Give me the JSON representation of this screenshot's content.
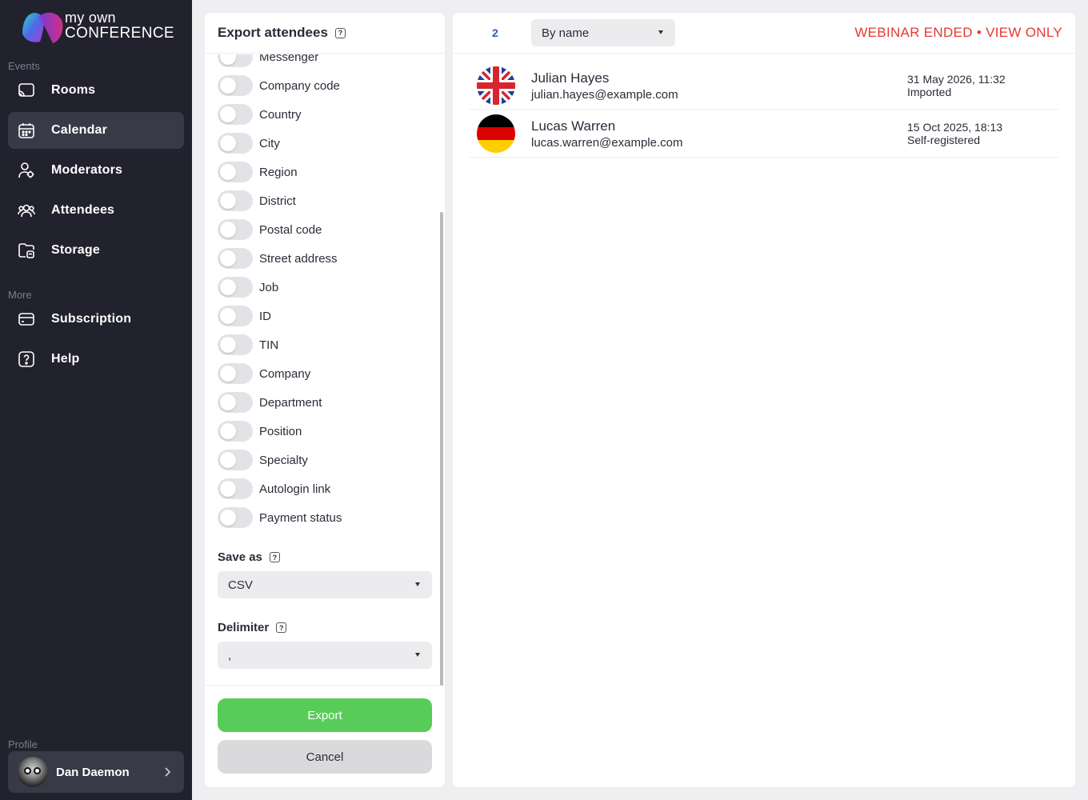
{
  "brand": {
    "line1": "my own",
    "line2": "CONFERENCE"
  },
  "sidebar": {
    "events_label": "Events",
    "more_label": "More",
    "profile_label": "Profile",
    "items": [
      {
        "label": "Rooms",
        "icon": "cast-icon",
        "active": false
      },
      {
        "label": "Calendar",
        "icon": "calendar-icon",
        "active": true
      },
      {
        "label": "Moderators",
        "icon": "user-gear-icon",
        "active": false
      },
      {
        "label": "Attendees",
        "icon": "users-icon",
        "active": false
      },
      {
        "label": "Storage",
        "icon": "folder-icon",
        "active": false
      }
    ],
    "more_items": [
      {
        "label": "Subscription",
        "icon": "card-icon"
      },
      {
        "label": "Help",
        "icon": "help-icon"
      }
    ],
    "profile_name": "Dan Daemon"
  },
  "export": {
    "title": "Export attendees",
    "fields": [
      "Messenger",
      "Company code",
      "Country",
      "City",
      "Region",
      "District",
      "Postal code",
      "Street address",
      "Job",
      "ID",
      "TIN",
      "Company",
      "Department",
      "Position",
      "Specialty",
      "Autologin link",
      "Payment status"
    ],
    "save_as_label": "Save as",
    "save_as_value": "CSV",
    "delimiter_label": "Delimiter",
    "delimiter_value": ",",
    "export_button": "Export",
    "cancel_button": "Cancel"
  },
  "list": {
    "count": "2",
    "sort_value": "By name",
    "status": "WEBINAR ENDED • VIEW ONLY",
    "attendees": [
      {
        "name": "Julian Hayes",
        "email": "julian.hayes@example.com",
        "date": "31 May 2026, 11:32",
        "source": "Imported",
        "flag": "uk-flag-icon"
      },
      {
        "name": "Lucas Warren",
        "email": "lucas.warren@example.com",
        "date": "15 Oct 2025, 18:13",
        "source": "Self-registered",
        "flag": "germany-flag-icon"
      }
    ]
  },
  "colors": {
    "sidebar_bg": "#22222e",
    "accent_green": "#57cc58",
    "status_red": "#e53935",
    "count_blue": "#2f5fb0"
  }
}
